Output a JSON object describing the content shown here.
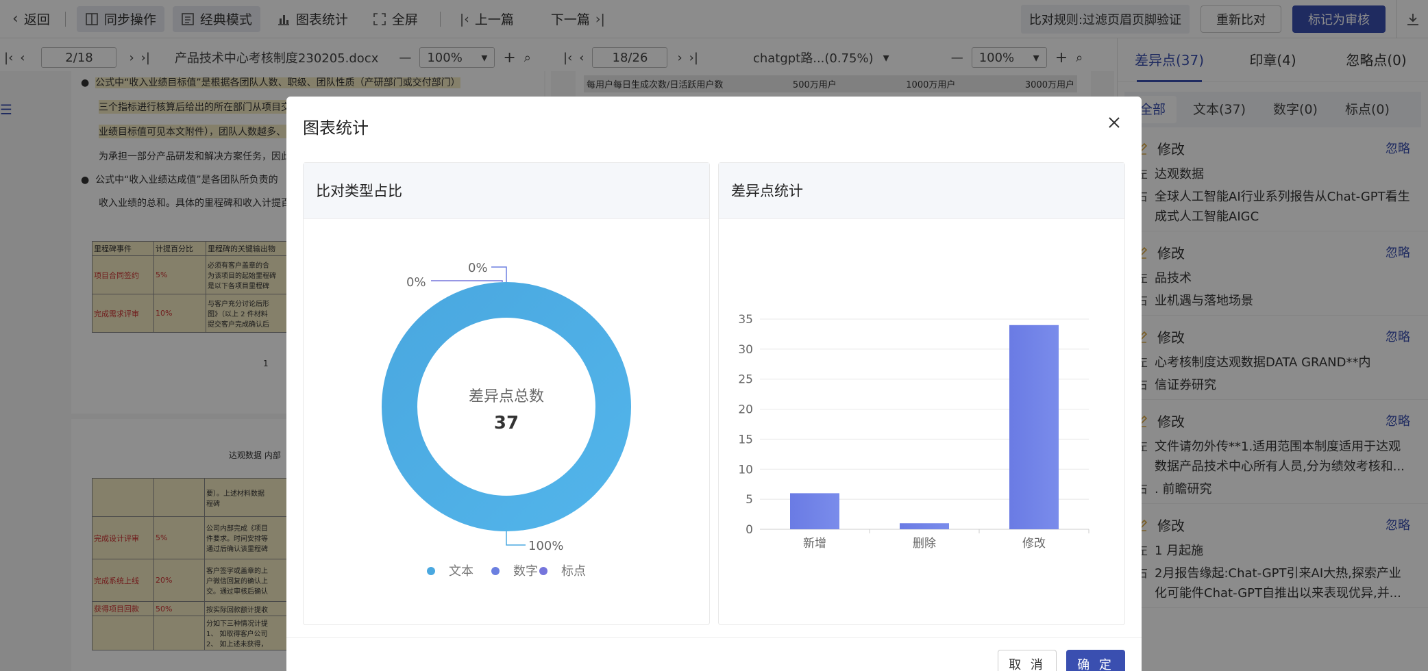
{
  "toolbar": {
    "back": "返回",
    "sync": "同步操作",
    "classic": "经典模式",
    "chart_stats": "图表统计",
    "fullscreen": "全屏",
    "prev": "上一篇",
    "next": "下一篇",
    "rule": "比对规则:过滤页眉页脚验证",
    "recompare": "重新比对",
    "mark_reviewed": "标记为审核"
  },
  "left_doc": {
    "page": "2/18",
    "file": "产品技术中心考核制度230205.docx",
    "zoom": "100%"
  },
  "right_doc": {
    "page": "18/26",
    "file": "chatgpt路...(0.75%)",
    "zoom": "100%",
    "header_row": [
      "每用户每日生成次数/日活跃用户数",
      "500万用户",
      "1000万用户",
      "3000万用户"
    ]
  },
  "left_doc_text": {
    "p1": "公式中“收入业绩目标值”是根据各团队人数、职级、团队性质（产研部门或交付部门）",
    "p2": "三个指标进行核算后给出的所在部门从项目交",
    "p3": "业绩目标值可见本文附件），团队人数越多、",
    "p4": "为承担一部分产品研发和解决方案任务，因此",
    "p5": "公式中“收入业绩达成值”是各团队所负责的",
    "p6": "收入业绩的总和。具体的里程碑和收入计提百",
    "table_head": [
      "里程碑事件",
      "计提百分比",
      "里程碑的关键输出物"
    ],
    "rows": [
      [
        "项目合同签约",
        "5%",
        "必须有客户盖章的合"
      ],
      [
        "完成需求评审",
        "10%",
        "与客户充分讨论后形"
      ]
    ],
    "row_extra": [
      "为该项目的起始里程碑",
      "是以下各项目里程碑",
      "图》（以上 2 件材料",
      "提交客户完成确认后"
    ],
    "page_num": "1",
    "footer": "达观数据 内部",
    "rows2": [
      [
        "完成设计评审",
        "5%",
        "公司内部完成《项目"
      ],
      [
        "完成系统上线",
        "20%",
        "客户签字或盖章的上"
      ],
      [
        "获得项目回款",
        "50%",
        "按实际回款额计提收"
      ]
    ],
    "row2_extra": [
      "要）。上述材料数据",
      "程碑",
      "件要求。时间安排等",
      "通过后确认该里程碑",
      "户微信回复的确认上",
      "交。通过审核后确认",
      "分如下三种情况计提",
      "1、 如取得客户公司",
      "2、 如上述未获得，"
    ]
  },
  "right_panel": {
    "tabs": [
      "差异点(37)",
      "印章(4)",
      "忽略点(0)"
    ],
    "subtabs": [
      "全部",
      "文本(37)",
      "数字(0)",
      "标点(0)"
    ],
    "left_label": "左",
    "right_label": "右",
    "items": [
      {
        "type": "修改",
        "ignore": "忽略",
        "left": "达观数据",
        "right": "全球人工智能AI行业系列报告从Chat-GPT看生成式人工智能AIGC"
      },
      {
        "type": "修改",
        "ignore": "忽略",
        "left": "品技术",
        "right": "业机遇与落地场景"
      },
      {
        "type": "修改",
        "ignore": "忽略",
        "left": "心考核制度达观数据DATA GRAND**内",
        "right": "信证券研究"
      },
      {
        "type": "修改",
        "ignore": "忽略",
        "left": "文件请勿外传**1.适用范围本制度适用于达观数据产品技术中心所有人员,分为绩效考核和...",
        "right": ". 前瞻研究"
      },
      {
        "type": "修改",
        "ignore": "忽略",
        "left": "1 月起施",
        "right": "2月报告缘起:Chat-GPT引来AI大热,探索产业化可能件Chat-GPT自推出以来表现优异,并..."
      }
    ]
  },
  "modal": {
    "title": "图表统计",
    "donut_card_title": "比对类型占比",
    "bar_card_title": "差异点统计",
    "cancel": "取 消",
    "ok": "确 定"
  },
  "chart_data": [
    {
      "type": "pie",
      "title": "比对类型占比",
      "center_label": "差异点总数",
      "center_value": "37",
      "labels": [
        "文本",
        "数字",
        "标点"
      ],
      "values": [
        37,
        0,
        0
      ],
      "percent_labels": [
        "100%",
        "0%",
        "0%"
      ],
      "legend": "bottom",
      "colors": [
        "#4aa8e0",
        "#6b7fe0",
        "#7575dc"
      ]
    },
    {
      "type": "bar",
      "title": "差异点统计",
      "categories": [
        "新增",
        "删除",
        "修改"
      ],
      "values": [
        6,
        1,
        34
      ],
      "ylim": [
        0,
        35
      ],
      "yticks": [
        0,
        5,
        10,
        15,
        20,
        25,
        30,
        35
      ],
      "grid": true,
      "color": "#6d80e6"
    }
  ]
}
